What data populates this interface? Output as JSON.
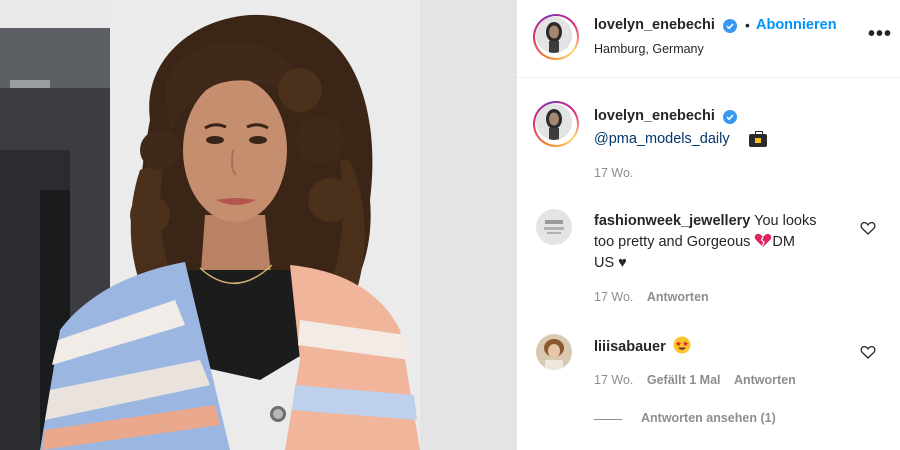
{
  "post": {
    "author": "lovelyn_enebechi",
    "follow_label": "Abonnieren",
    "separator": "•",
    "location": "Hamburg, Germany",
    "more_label": "•••"
  },
  "caption": {
    "author": "lovelyn_enebechi",
    "mention": "@pma_models_daily",
    "time": "17 Wo."
  },
  "comments": [
    {
      "user": "fashionweek_jewellery",
      "text_part1": " You looks",
      "text_part2": "too pretty and Gorgeous ",
      "text_part3": "DM",
      "text_part4": "US ♥",
      "time": "17 Wo.",
      "reply_label": "Antworten"
    },
    {
      "user": "liiisabauer",
      "time": "17 Wo.",
      "likes": "Gefällt 1 Mal",
      "reply_label": "Antworten",
      "view_replies": "Antworten ansehen (1)"
    }
  ],
  "colors": {
    "link_blue": "#0095f6",
    "mention_blue": "#00376b",
    "muted": "#8e8e8e",
    "text": "#262626"
  }
}
